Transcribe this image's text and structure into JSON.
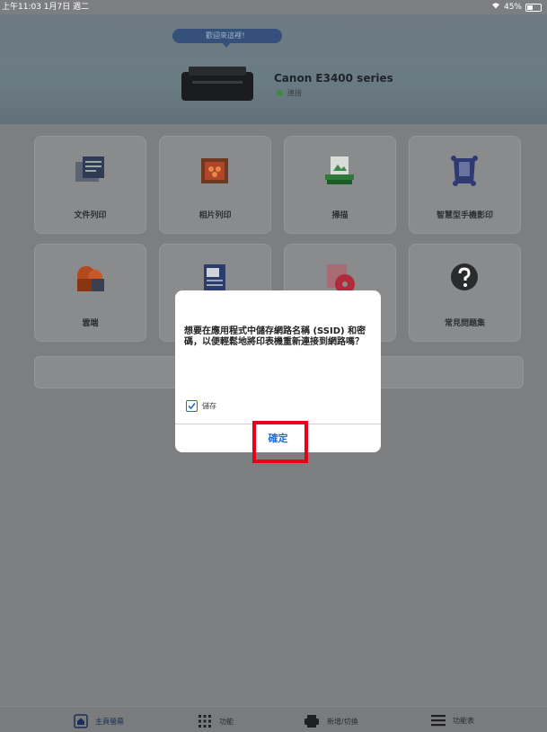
{
  "status_bar": {
    "time": "上午11:03  1月7日 週二",
    "battery": "45%",
    "battery_level": 0.45
  },
  "header": {
    "banner": "歡迎來這裡！",
    "printer_name": "Canon E3400 series",
    "printer_status": "連接"
  },
  "tiles": [
    {
      "label": "文件列印",
      "icon": "document-print-icon"
    },
    {
      "label": "相片列印",
      "icon": "photo-print-icon"
    },
    {
      "label": "掃描",
      "icon": "scan-icon"
    },
    {
      "label": "智慧型手機影印",
      "icon": "smartphone-copy-icon"
    },
    {
      "label": "雲端",
      "icon": "cloud-icon"
    },
    {
      "label": "",
      "icon": "document-scan-icon"
    },
    {
      "label": "",
      "icon": "disc-label-icon"
    },
    {
      "label": "常見問題集",
      "icon": "faq-icon"
    }
  ],
  "dialog": {
    "message": "想要在應用程式中儲存網路名稱 (SSID) 和密碼，以便輕鬆地將印表機重新連接到網路嗎？",
    "checkbox_label": "儲存",
    "checkbox_checked": true,
    "ok_label": "確定"
  },
  "tabbar": {
    "items": [
      {
        "label": "主頁螢幕",
        "icon": "home-icon",
        "active": true
      },
      {
        "label": "功能",
        "icon": "grid-icon",
        "active": false
      },
      {
        "label": "新增/切換",
        "icon": "printer-icon",
        "active": false
      },
      {
        "label": "功能表",
        "icon": "menu-icon",
        "active": false
      }
    ]
  }
}
